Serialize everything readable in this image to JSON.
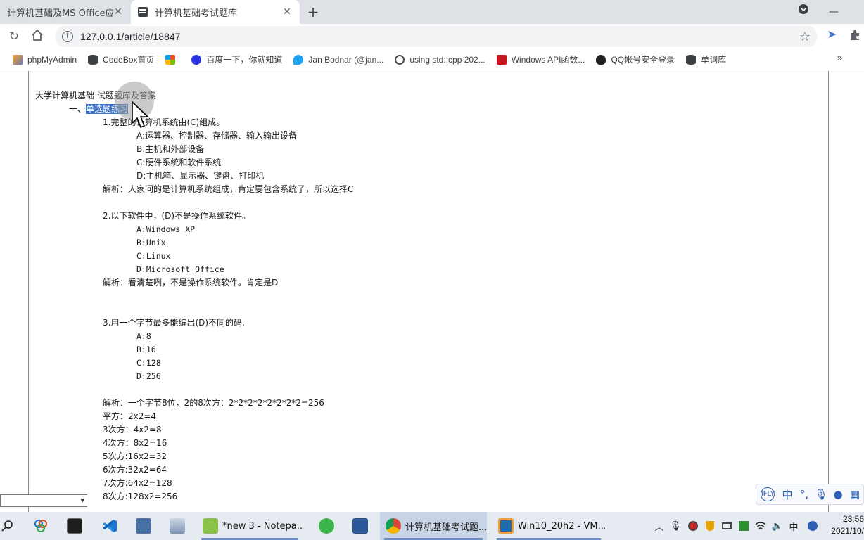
{
  "browser": {
    "tabs": [
      {
        "label": "计算机基础及MS Office应用",
        "active": false
      },
      {
        "label": "计算机基础考试题库",
        "active": true
      }
    ],
    "url": "127.0.0.1/article/18847",
    "bookmarks": [
      {
        "label": "phpMyAdmin",
        "icon": "pma-icon"
      },
      {
        "label": "CodeBox首页",
        "icon": "database-icon"
      },
      {
        "label": "",
        "icon": "windows-icon"
      },
      {
        "label": "百度一下，你就知道",
        "icon": "baidu-icon"
      },
      {
        "label": "Jan Bodnar (@jan...",
        "icon": "twitter-icon"
      },
      {
        "label": "using std::cpp 202...",
        "icon": "wordpress-icon"
      },
      {
        "label": "Windows API函数...",
        "icon": "c-icon"
      },
      {
        "label": "QQ帐号安全登录",
        "icon": "qq-icon"
      },
      {
        "label": "单词库",
        "icon": "database-icon"
      }
    ]
  },
  "article": {
    "title": "大学计算机基础 试题题库及答案",
    "section_prefix": "一、",
    "section_highlight": "单选题练习",
    "q1": {
      "question": "1.完整的计算机系统由(C)组成。",
      "options": [
        "A:运算器、控制器、存储器、输入输出设备",
        "B:主机和外部设备",
        "C:硬件系统和软件系统",
        "D:主机箱、显示器、键盘、打印机"
      ],
      "analysis": "解析：人家问的是计算机系统组成，肯定要包含系统了，所以选择C"
    },
    "q2": {
      "question": "2.以下软件中，(D)不是操作系统软件。",
      "options": [
        "A:Windows XP",
        "B:Unix",
        "C:Linux",
        "D:Microsoft Office"
      ],
      "analysis": "解析：看清楚咧，不是操作系统软件。肯定是D"
    },
    "q3": {
      "question": "3.用一个字节最多能编出(D)不同的码.",
      "options": [
        "A:8",
        "B:16",
        "C:128",
        "D:256"
      ],
      "analysis": "解析：一个字节8位，2的8次方：2*2*2*2*2*2*2*2=256",
      "powers": [
        "平方：2x2=4",
        "3次方：4x2=8",
        "4次方：8x2=16",
        "5次方:16x2=32",
        "6次方:32x2=64",
        "7次方:64x2=128",
        "8次方:128x2=256"
      ]
    }
  },
  "ime": {
    "lang": "中"
  },
  "taskbar": {
    "tasks": [
      {
        "label": "*new 3 - Notepa..."
      },
      {
        "label": "计算机基础考试题..."
      },
      {
        "label": "Win10_20h2 - VM..."
      }
    ],
    "tray_lang": "中",
    "time": "23:56",
    "date": "2021/10/"
  }
}
